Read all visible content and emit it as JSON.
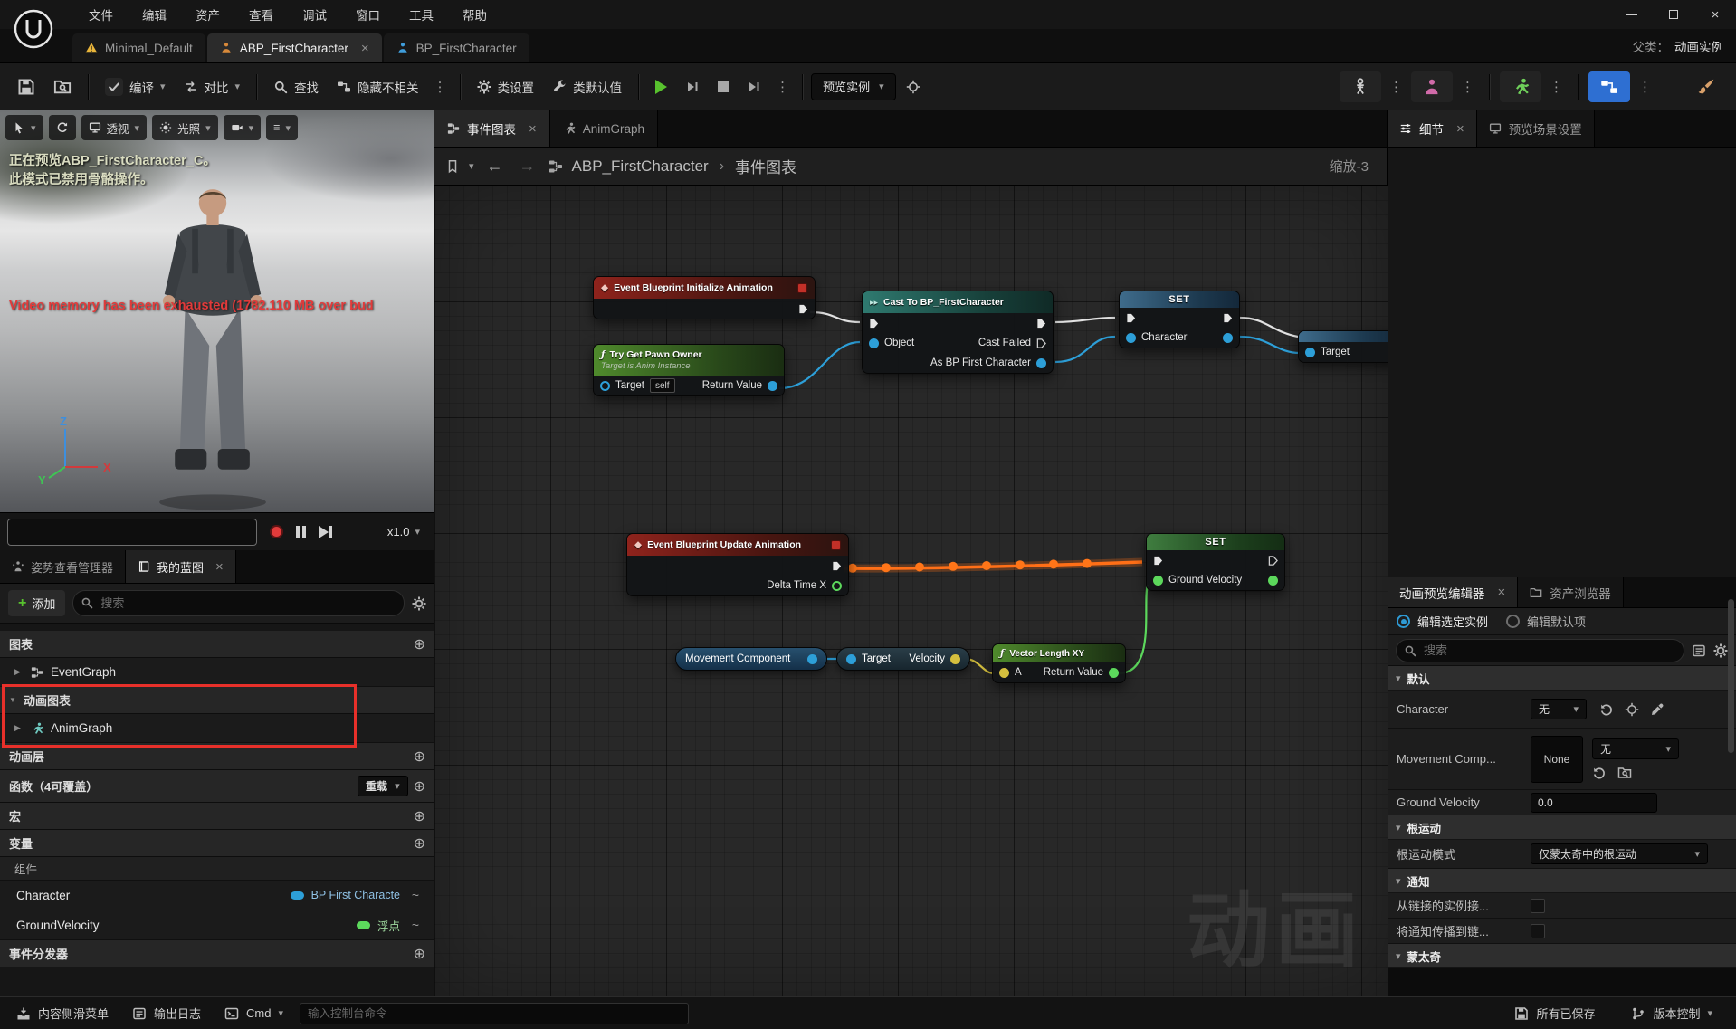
{
  "glyphs": {
    "ellipsis": "⋮",
    "chev": "▾",
    "close": "×",
    "tri_r": "▶",
    "tri_d": "▼",
    "plus_o": "⊕",
    "back": "←",
    "fwd": "→",
    "sep": "›",
    "tilde": "~",
    "hamb": "≡",
    "diamond": "◆",
    "fn": "ƒ",
    "cast_arrows": "▸▸"
  },
  "menu": {
    "items": [
      "文件",
      "编辑",
      "资产",
      "查看",
      "调试",
      "窗口",
      "工具",
      "帮助"
    ]
  },
  "tabsbar": {
    "tabs": [
      {
        "label": "Minimal_Default"
      },
      {
        "label": "ABP_FirstCharacter"
      },
      {
        "label": "BP_FirstCharacter"
      }
    ],
    "parent_label": "父类：",
    "parent_value": "动画实例"
  },
  "toolbar": {
    "compile": "编译",
    "diff": "对比",
    "find": "查找",
    "hide_unrelated": "隐藏不相关",
    "class_settings": "类设置",
    "class_defaults": "类默认值",
    "preview_instance": "预览实例"
  },
  "viewport": {
    "perspective": "透视",
    "lit": "光照",
    "preview_line1": "正在预览ABP_FirstCharacter_C。",
    "preview_line2": "此模式已禁用骨骼操作。",
    "error": "Video memory has been exhausted (1782.110 MB over bud",
    "speed": "x1.0",
    "axis_x": "X",
    "axis_y": "Y",
    "axis_z": "Z"
  },
  "mybp": {
    "tab_pose": "姿势查看管理器",
    "tab_my": "我的蓝图",
    "add": "添加",
    "search_placeholder": "搜索",
    "sec_graphs": "图表",
    "item_eventgraph": "EventGraph",
    "sec_animgraphs": "动画图表",
    "item_animgraph": "AnimGraph",
    "sec_animlayers": "动画层",
    "sec_functions": "函数（4可覆盖）",
    "overload": "重载",
    "sec_macros": "宏",
    "sec_variables": "变量",
    "group_components": "组件",
    "var1_name": "Character",
    "var1_type": "BP First Characte",
    "var2_name": "GroundVelocity",
    "var2_type": "浮点",
    "sec_dispatchers": "事件分发器"
  },
  "graph": {
    "tab_event": "事件图表",
    "tab_anim": "AnimGraph",
    "crumb_root": "ABP_FirstCharacter",
    "crumb_leaf": "事件图表",
    "zoom": "缩放-3",
    "watermark": "动画",
    "nodes": {
      "init": {
        "title": "Event Blueprint Initialize Animation"
      },
      "trynode": {
        "title": "Try Get Pawn Owner",
        "subtitle": "Target is Anim Instance",
        "target": "Target",
        "selfval": "self",
        "ret": "Return Value"
      },
      "cast": {
        "title": "Cast To BP_FirstCharacter",
        "object": "Object",
        "cast_failed": "Cast Failed",
        "as_label": "As BP First Character"
      },
      "set_char": {
        "title": "SET",
        "pin": "Character"
      },
      "frag": {
        "pin": "Target"
      },
      "update": {
        "title": "Event Blueprint Update Animation",
        "delta": "Delta Time X"
      },
      "set_gv": {
        "title": "SET",
        "pin": "Ground Velocity"
      },
      "movement": {
        "title": "Movement Component"
      },
      "getvel": {
        "target": "Target",
        "velocity": "Velocity"
      },
      "vlxy": {
        "title": "Vector Length XY",
        "a": "A",
        "ret": "Return Value"
      }
    }
  },
  "details": {
    "tab_details": "细节",
    "tab_preview_scene": "预览场景设置",
    "tab_anim_preview": "动画预览编辑器",
    "tab_asset_browser": "资产浏览器",
    "radio_instance": "编辑选定实例",
    "radio_defaults": "编辑默认项",
    "search_placeholder": "搜索",
    "sec_default": "默认",
    "row_character": "Character",
    "val_none": "无",
    "row_movement": "Movement Comp...",
    "val_none_box": "None",
    "row_ground": "Ground Velocity",
    "val_ground": "0.0",
    "sec_rootmotion": "根运动",
    "row_rootmode": "根运动模式",
    "val_rootmode": "仅蒙太奇中的根运动",
    "sec_notify": "通知",
    "row_notify1": "从链接的实例接...",
    "row_notify2": "将通知传播到链...",
    "sec_montage": "蒙太奇"
  },
  "statusbar": {
    "content_drawer": "内容侧滑菜单",
    "output_log": "输出日志",
    "cmd": "Cmd",
    "console_placeholder": "输入控制台命令",
    "all_saved": "所有已保存",
    "revision_control": "版本控制"
  }
}
